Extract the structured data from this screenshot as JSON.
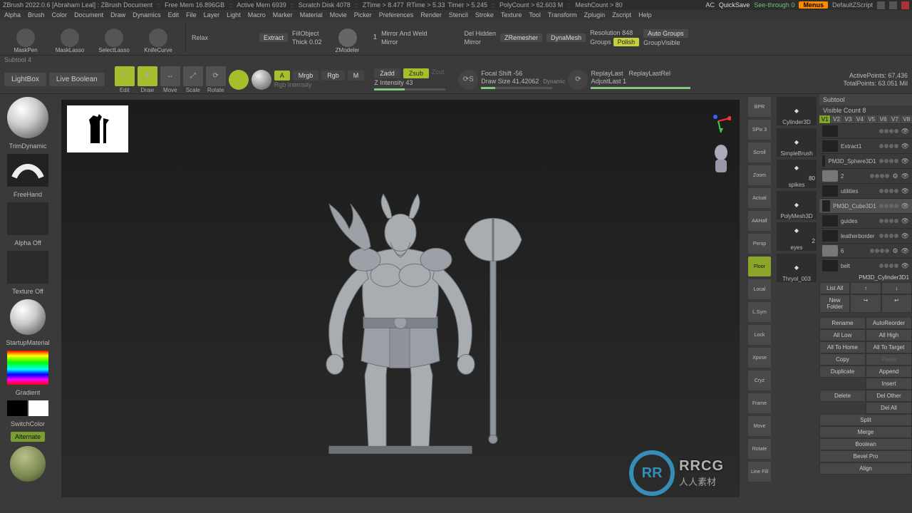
{
  "title": {
    "app": "ZBrush 2022.0.6 [Abraham Leal] : ZBrush Document",
    "freemem": "Free Mem 16.896GB",
    "activemem": "Active Mem 6939",
    "scratch": "Scratch Disk 4078",
    "ztime": "ZTime > 8.477",
    "rtime": "RTime > 5.33",
    "timer": "Timer > 5.245",
    "polycount": "PolyCount > 62.603 M",
    "meshcount": "MeshCount > 80",
    "right": {
      "ac": "AC",
      "quicksave": "QuickSave",
      "seethrough": "See-through 0",
      "menus": "Menus",
      "defaultz": "DefaultZScript"
    }
  },
  "menus": [
    "Alpha",
    "Brush",
    "Color",
    "Document",
    "Draw",
    "Dynamics",
    "Edit",
    "File",
    "Layer",
    "Light",
    "Macro",
    "Marker",
    "Material",
    "Movie",
    "Picker",
    "Preferences",
    "Render",
    "Stencil",
    "Stroke",
    "Texture",
    "Tool",
    "Transform",
    "Zplugin",
    "Zscript",
    "Help"
  ],
  "shelf": {
    "masks": [
      "MaskPen",
      "MaskLasso",
      "SelectLasso",
      "KnifeCurve"
    ],
    "relax": "Relax",
    "extract": "Extract",
    "fillobject": "FillObject",
    "thick": "Thick 0.02",
    "zmodeler": "ZModeler",
    "mirrorandweld": "Mirror And Weld",
    "mirror1": "Mirror",
    "delhidden": "Del Hidden",
    "mirror2": "Mirror",
    "zremesher": "ZRemesher",
    "dynamesh": "DynaMesh",
    "resolution": "Resolution 848",
    "groups": "Groups",
    "polish": "Polish",
    "autogroups": "Auto Groups",
    "groupvisible": "GroupVisible",
    "onebox": "1"
  },
  "subtool_label": "Subtool 4",
  "tb2": {
    "lightbox": "LightBox",
    "liveboolean": "Live Boolean",
    "mode_labels": [
      "Edit",
      "Draw",
      "Move",
      "Scale",
      "Rotate"
    ],
    "mrgb_a": "A",
    "mrgb": "Mrgb",
    "rgb": "Rgb",
    "m": "M",
    "rgbint": "Rgb Intensity",
    "zadd": "Zadd",
    "zsub": "Zsub",
    "zcut": "Zcut",
    "zintensity": "Z Intensity 43",
    "focal": "Focal Shift -56",
    "drawsize": "Draw Size 41.42062",
    "dynamic": "Dynamic",
    "replaylast": "ReplayLast",
    "replaylastrel": "ReplayLastRel",
    "adjustlast": "AdjustLast 1",
    "activepoints": "ActivePoints: 67,436",
    "totalpoints": "TotalPoints: 63.051 Mil"
  },
  "left": {
    "brush": "TrimDynamic",
    "stroke": "FreeHand",
    "alpha": "Alpha Off",
    "texture": "Texture Off",
    "material": "StartupMaterial",
    "gradient": "Gradient",
    "switch": "SwitchColor",
    "alternate": "Alternate"
  },
  "rstrip": [
    "BPR",
    "SPix 3",
    "Scroll",
    "Zoom",
    "Actual",
    "AAHalf",
    "Persp",
    "Floor",
    "Local",
    "L.Sym",
    "Lock",
    "Xpose",
    "Cryz",
    "Frame",
    "Move",
    "Rotate",
    "Line Fill"
  ],
  "rstrip_on_index": 7,
  "toolslots": [
    "Cylinder3D",
    "SimpleBrush",
    "spikes",
    "PolyMesh3D",
    "eyes",
    "Thryol_003"
  ],
  "toolslots_counts": {
    "spikes": "80",
    "eyes": "2"
  },
  "sub": {
    "panel": "Subtool",
    "visible": "Visible Count 8",
    "views": [
      "V1",
      "V2",
      "V3",
      "V4",
      "V5",
      "V6",
      "V7",
      "V8"
    ],
    "items": [
      {
        "name": "",
        "type": "tool"
      },
      {
        "name": "Extract1",
        "type": "tool"
      },
      {
        "name": "PM3D_Sphere3D1",
        "type": "tool"
      },
      {
        "name": "2",
        "type": "folder",
        "gear": true
      },
      {
        "name": "utilities",
        "type": "tool"
      },
      {
        "name": "PM3D_Cube3D1",
        "type": "tool",
        "active": true
      },
      {
        "name": "guides",
        "type": "tool"
      },
      {
        "name": "leatherborder",
        "type": "tool"
      },
      {
        "name": "6",
        "type": "folder",
        "gear": true
      },
      {
        "name": "belt",
        "type": "tool"
      },
      {
        "name": "PM3D_Cylinder3D1",
        "type": "label"
      }
    ],
    "btns": {
      "listall": "List All",
      "newfolder": "New Folder",
      "rename": "Rename",
      "autoreorder": "AutoReorder",
      "alllow": "All Low",
      "allhigh": "All High",
      "alltohome": "All To Home",
      "alltotarget": "All To Target",
      "copy": "Copy",
      "paste": "Paste",
      "duplicate": "Duplicate",
      "append": "Append",
      "insert": "Insert",
      "delete": "Delete",
      "delother": "Del Other",
      "delall": "Del All",
      "split": "Split",
      "merge": "Merge",
      "boolean": "Boolean",
      "bevelpro": "Bevel Pro",
      "align": "Align"
    }
  },
  "watermark": {
    "brand": "RRCG",
    "sub": "人人素材"
  }
}
